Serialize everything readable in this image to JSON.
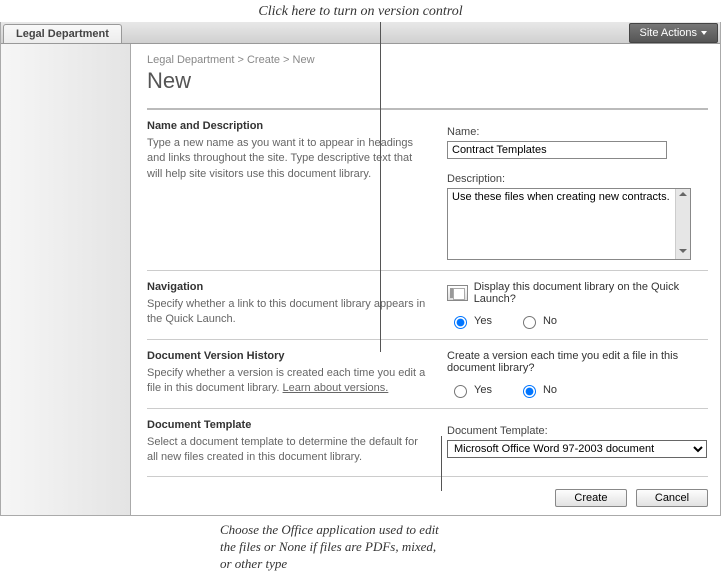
{
  "annotations": {
    "top": "Click here to turn on version control",
    "bottom_line1": "Choose the Office application used to edit",
    "bottom_line2": "the files or None if files are PDFs, mixed,",
    "bottom_line3": "or other type"
  },
  "topbar": {
    "tab_label": "Legal Department",
    "site_actions": "Site Actions"
  },
  "breadcrumb": "Legal Department > Create > New",
  "page_title": "New",
  "sections": {
    "name_desc": {
      "title": "Name and Description",
      "desc": "Type a new name as you want it to appear in headings and links throughout the site. Type descriptive text that will help site visitors use this document library."
    },
    "navigation": {
      "title": "Navigation",
      "desc": "Specify whether a link to this document library appears in the Quick Launch."
    },
    "version": {
      "title": "Document Version History",
      "desc_prefix": "Specify whether a version is created each time you edit a file in this document library.   ",
      "desc_link": "Learn about versions."
    },
    "template": {
      "title": "Document Template",
      "desc": "Select a document template to determine the default for all new files created in this document library."
    }
  },
  "fields": {
    "name_label": "Name:",
    "name_value": "Contract Templates",
    "desc_label": "Description:",
    "desc_value": "Use these files when creating new contracts.",
    "ql_question": "Display this document library on the Quick Launch?",
    "version_question": "Create a version each time you edit a file in this document library?",
    "template_label": "Document Template:",
    "template_value": "Microsoft Office Word 97-2003 document",
    "yes": "Yes",
    "no": "No"
  },
  "buttons": {
    "create": "Create",
    "cancel": "Cancel"
  }
}
